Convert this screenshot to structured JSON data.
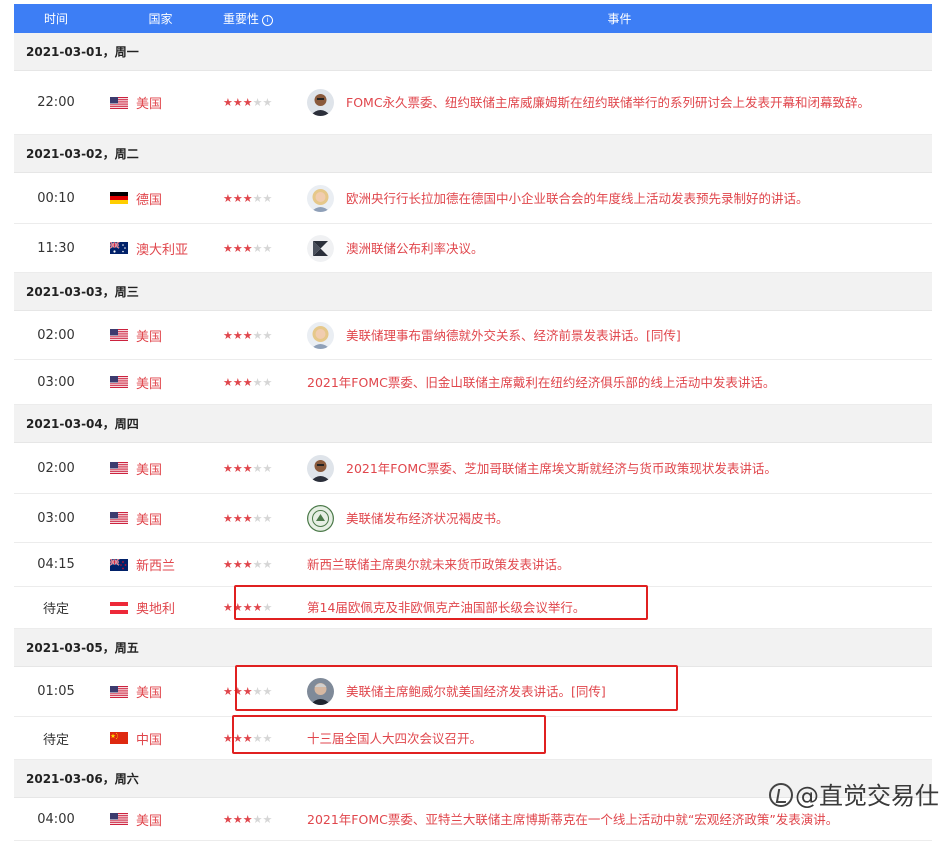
{
  "header": {
    "time": "时间",
    "country": "国家",
    "importance": "重要性",
    "info_glyph": "i",
    "event": "事件"
  },
  "colors": {
    "header_bg": "#3d7ef5",
    "event_text": "#e0464c",
    "date_bg": "#f2f2f2",
    "highlight": "#e02020"
  },
  "days": [
    {
      "date": "2021-03-01，周一",
      "events": [
        {
          "time": "22:00",
          "country": "美国",
          "flag": "us",
          "stars": 3,
          "avatar": "person-avatar-dark",
          "text": "FOMC永久票委、纽约联储主席威廉姆斯在纽约联储举行的系列研讨会上发表开幕和闭幕致辞。"
        }
      ]
    },
    {
      "date": "2021-03-02，周二",
      "events": [
        {
          "time": "00:10",
          "country": "德国",
          "flag": "de",
          "stars": 3,
          "avatar": "person-avatar-blonde",
          "text": "欧洲央行行长拉加德在德国中小企业联合会的年度线上活动发表预先录制好的讲话。"
        },
        {
          "time": "11:30",
          "country": "澳大利亚",
          "flag": "au",
          "stars": 3,
          "avatar": "rba-logo",
          "text": "澳洲联储公布利率决议。"
        }
      ]
    },
    {
      "date": "2021-03-03，周三",
      "events": [
        {
          "time": "02:00",
          "country": "美国",
          "flag": "us",
          "stars": 3,
          "avatar": "person-avatar-blonde",
          "text": "美联储理事布雷纳德就外交关系、经济前景发表讲话。[同传]"
        },
        {
          "time": "03:00",
          "country": "美国",
          "flag": "us",
          "stars": 3,
          "avatar": "",
          "text": "2021年FOMC票委、旧金山联储主席戴利在纽约经济俱乐部的线上活动中发表讲话。"
        }
      ]
    },
    {
      "date": "2021-03-04，周四",
      "events": [
        {
          "time": "02:00",
          "country": "美国",
          "flag": "us",
          "stars": 3,
          "avatar": "person-avatar-dark",
          "text": "2021年FOMC票委、芝加哥联储主席埃文斯就经济与货币政策现状发表讲话。"
        },
        {
          "time": "03:00",
          "country": "美国",
          "flag": "us",
          "stars": 3,
          "avatar": "fed-seal",
          "text": "美联储发布经济状况褐皮书。"
        },
        {
          "time": "04:15",
          "country": "新西兰",
          "flag": "nz",
          "stars": 3,
          "avatar": "",
          "text": "新西兰联储主席奥尔就未来货币政策发表讲话。"
        },
        {
          "time": "待定",
          "country": "奥地利",
          "flag": "at",
          "stars": 4,
          "avatar": "",
          "text": "第14届欧佩克及非欧佩克产油国部长级会议举行。"
        }
      ]
    },
    {
      "date": "2021-03-05，周五",
      "events": [
        {
          "time": "01:05",
          "country": "美国",
          "flag": "us",
          "stars": 3,
          "avatar": "person-avatar-grey",
          "text": "美联储主席鲍威尔就美国经济发表讲话。[同传]"
        },
        {
          "time": "待定",
          "country": "中国",
          "flag": "cn",
          "stars": 3,
          "avatar": "",
          "text": "十三届全国人大四次会议召开。"
        }
      ]
    },
    {
      "date": "2021-03-06，周六",
      "events": [
        {
          "time": "04:00",
          "country": "美国",
          "flag": "us",
          "stars": 3,
          "avatar": "",
          "text": "2021年FOMC票委、亚特兰大联储主席博斯蒂克在一个线上活动中就“宏观经济政策”发表演讲。"
        }
      ]
    }
  ],
  "watermark": "@直觉交易仕"
}
